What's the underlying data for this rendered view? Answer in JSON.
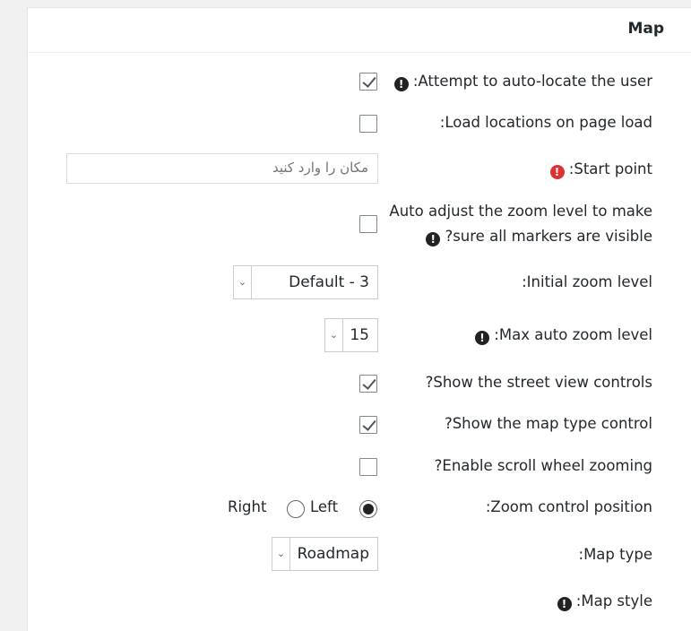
{
  "section": {
    "title": "Map"
  },
  "rows": {
    "auto_locate": {
      "label": ":Attempt to auto-locate the user",
      "checked": true
    },
    "load_locations": {
      "label": ":Load locations on page load",
      "checked": false
    },
    "start_point": {
      "label": ":Start point",
      "placeholder": "مکان را وارد کنید"
    },
    "auto_adjust": {
      "label_line1": "Auto adjust the zoom level to make",
      "label_line2": "?sure all markers are visible",
      "checked": false
    },
    "initial_zoom": {
      "label": ":Initial zoom level",
      "value": "Default - 3"
    },
    "max_zoom": {
      "label": ":Max auto zoom level",
      "value": "15"
    },
    "street_view": {
      "label": "?Show the street view controls",
      "checked": true
    },
    "map_type_control": {
      "label": "?Show the map type control",
      "checked": true
    },
    "scroll_wheel": {
      "label": "?Enable scroll wheel zooming",
      "checked": false
    },
    "zoom_position": {
      "label": ":Zoom control position",
      "options": [
        "Left",
        "Right"
      ],
      "selected": "Left"
    },
    "map_type": {
      "label": ":Map type",
      "value": "Roadmap"
    },
    "map_style": {
      "label": ":Map style"
    }
  },
  "icons": {
    "info": "!"
  }
}
